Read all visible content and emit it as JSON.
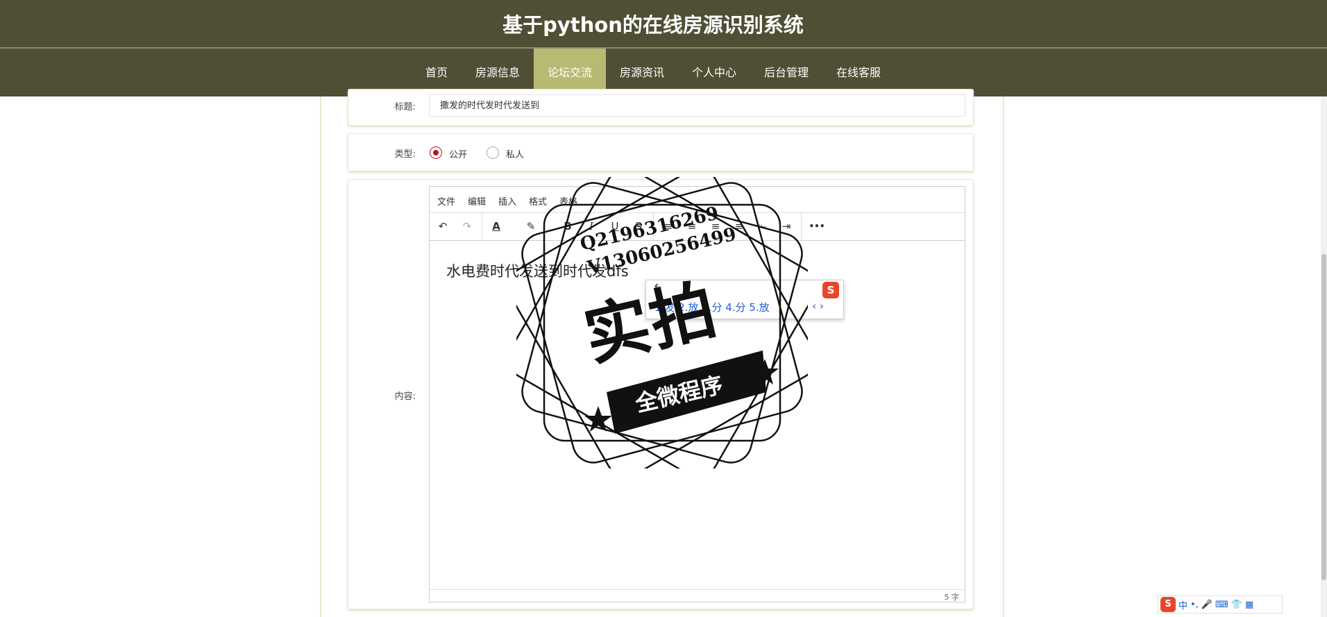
{
  "header": {
    "site_title": "基于python的在线房源识别系统",
    "nav": [
      {
        "label": "首页"
      },
      {
        "label": "房源信息"
      },
      {
        "label": "论坛交流",
        "active": true
      },
      {
        "label": "房源资讯"
      },
      {
        "label": "个人中心"
      },
      {
        "label": "后台管理"
      },
      {
        "label": "在线客服"
      }
    ]
  },
  "form": {
    "title_label": "标题:",
    "title_value": "撒发的时代发时代发送到",
    "type_label": "类型:",
    "type_options": [
      {
        "label": "公开",
        "checked": true
      },
      {
        "label": "私人",
        "checked": false
      }
    ],
    "content_label": "内容:"
  },
  "editor": {
    "menu": [
      "文件",
      "编辑",
      "插入",
      "格式",
      "表格"
    ],
    "toolbar_icons": [
      "undo-icon",
      "redo-icon",
      "font-color-icon",
      "highlight-icon",
      "bold-icon",
      "italic-icon",
      "underline-icon",
      "strikethrough-icon",
      "align-left-icon",
      "align-center-icon",
      "align-right-icon",
      "align-justify-icon",
      "outdent-icon",
      "indent-icon",
      "more-icon"
    ],
    "toolbar_glyphs": {
      "undo": "↶",
      "redo": "↷",
      "font_color": "A",
      "highlight": "✎",
      "bold": "B",
      "italic": "I",
      "underline": "U",
      "strike": "S",
      "align_left": "≡",
      "align_center": "≡",
      "align_right": "≡",
      "justify": "≡",
      "outdent": "⇤",
      "indent": "⇥",
      "more": "•••"
    },
    "body_text": "水电费时代发送到时代发dfs",
    "word_count": "5 字"
  },
  "ime_popup": {
    "input": "f",
    "candidates": "1.发 2.放 3.分 4.分 5.放",
    "nav": "‹ ›",
    "logo": "S"
  },
  "watermark": {
    "contact_q": "Q2196316269",
    "contact_v": "V13060256499",
    "main": "实拍",
    "sub": "全微程序"
  },
  "taskbar_ime": {
    "logo": "S",
    "items": [
      "中",
      "•,",
      "🎤",
      "⌨",
      "👕",
      "▦"
    ]
  },
  "colors": {
    "header_bg": "#4f4f35",
    "nav_active_bg": "#b7ba72",
    "radio_checked": "#c0141e"
  }
}
